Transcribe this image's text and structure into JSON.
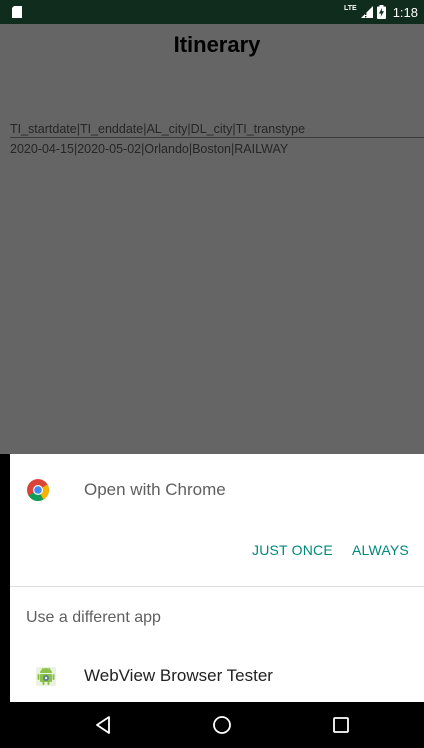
{
  "status_bar": {
    "network": "LTE",
    "time": "1:18"
  },
  "app": {
    "title": "Itinerary",
    "table": {
      "header": "TI_startdate|TI_enddate|AL_city|DL_city|TI_transtype",
      "rows": [
        "2020-04-15|2020-05-02|Orlando|Boston|RAILWAY"
      ]
    }
  },
  "chooser": {
    "primary_app_label": "Open with Chrome",
    "just_once_label": "JUST ONCE",
    "always_label": "ALWAYS",
    "different_app_label": "Use a different app",
    "alt_app_label": "WebView Browser Tester"
  },
  "colors": {
    "accent": "#00897b",
    "status_bar": "#0f2c1c",
    "dim_overlay": "#656565"
  }
}
